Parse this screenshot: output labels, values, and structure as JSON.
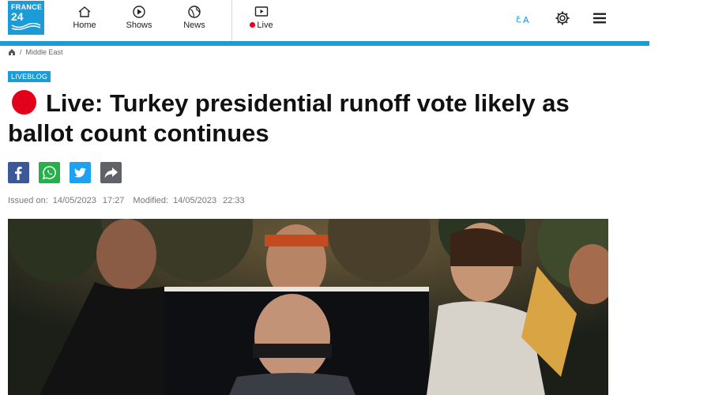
{
  "brand": {
    "logo_line1": "FRANCE",
    "logo_line2": "24",
    "brand_color": "#1d9bd7",
    "live_color": "#e3001b"
  },
  "nav": [
    {
      "label": "Home",
      "icon": "home-icon"
    },
    {
      "label": "Shows",
      "icon": "play-circle-icon"
    },
    {
      "label": "News",
      "icon": "globe-icon"
    },
    {
      "label": "Live",
      "icon": "tv-play-icon"
    }
  ],
  "header_icons": [
    "language-icon",
    "gear-icon",
    "hamburger-menu-icon"
  ],
  "breadcrumb": {
    "separator": "/",
    "section": "Middle East"
  },
  "badge": "LIVEBLOG",
  "title": "Live: Turkey presidential runoff vote likely as ballot count continues",
  "share": [
    "facebook-icon",
    "whatsapp-icon",
    "twitter-icon",
    "share-arrow-icon"
  ],
  "dates": {
    "issued_label": "Issued on:",
    "issued_date": "14/05/2023",
    "issued_time": "17:27",
    "modified_label": "Modified:",
    "modified_date": "14/05/2023",
    "modified_time": "22:33"
  }
}
